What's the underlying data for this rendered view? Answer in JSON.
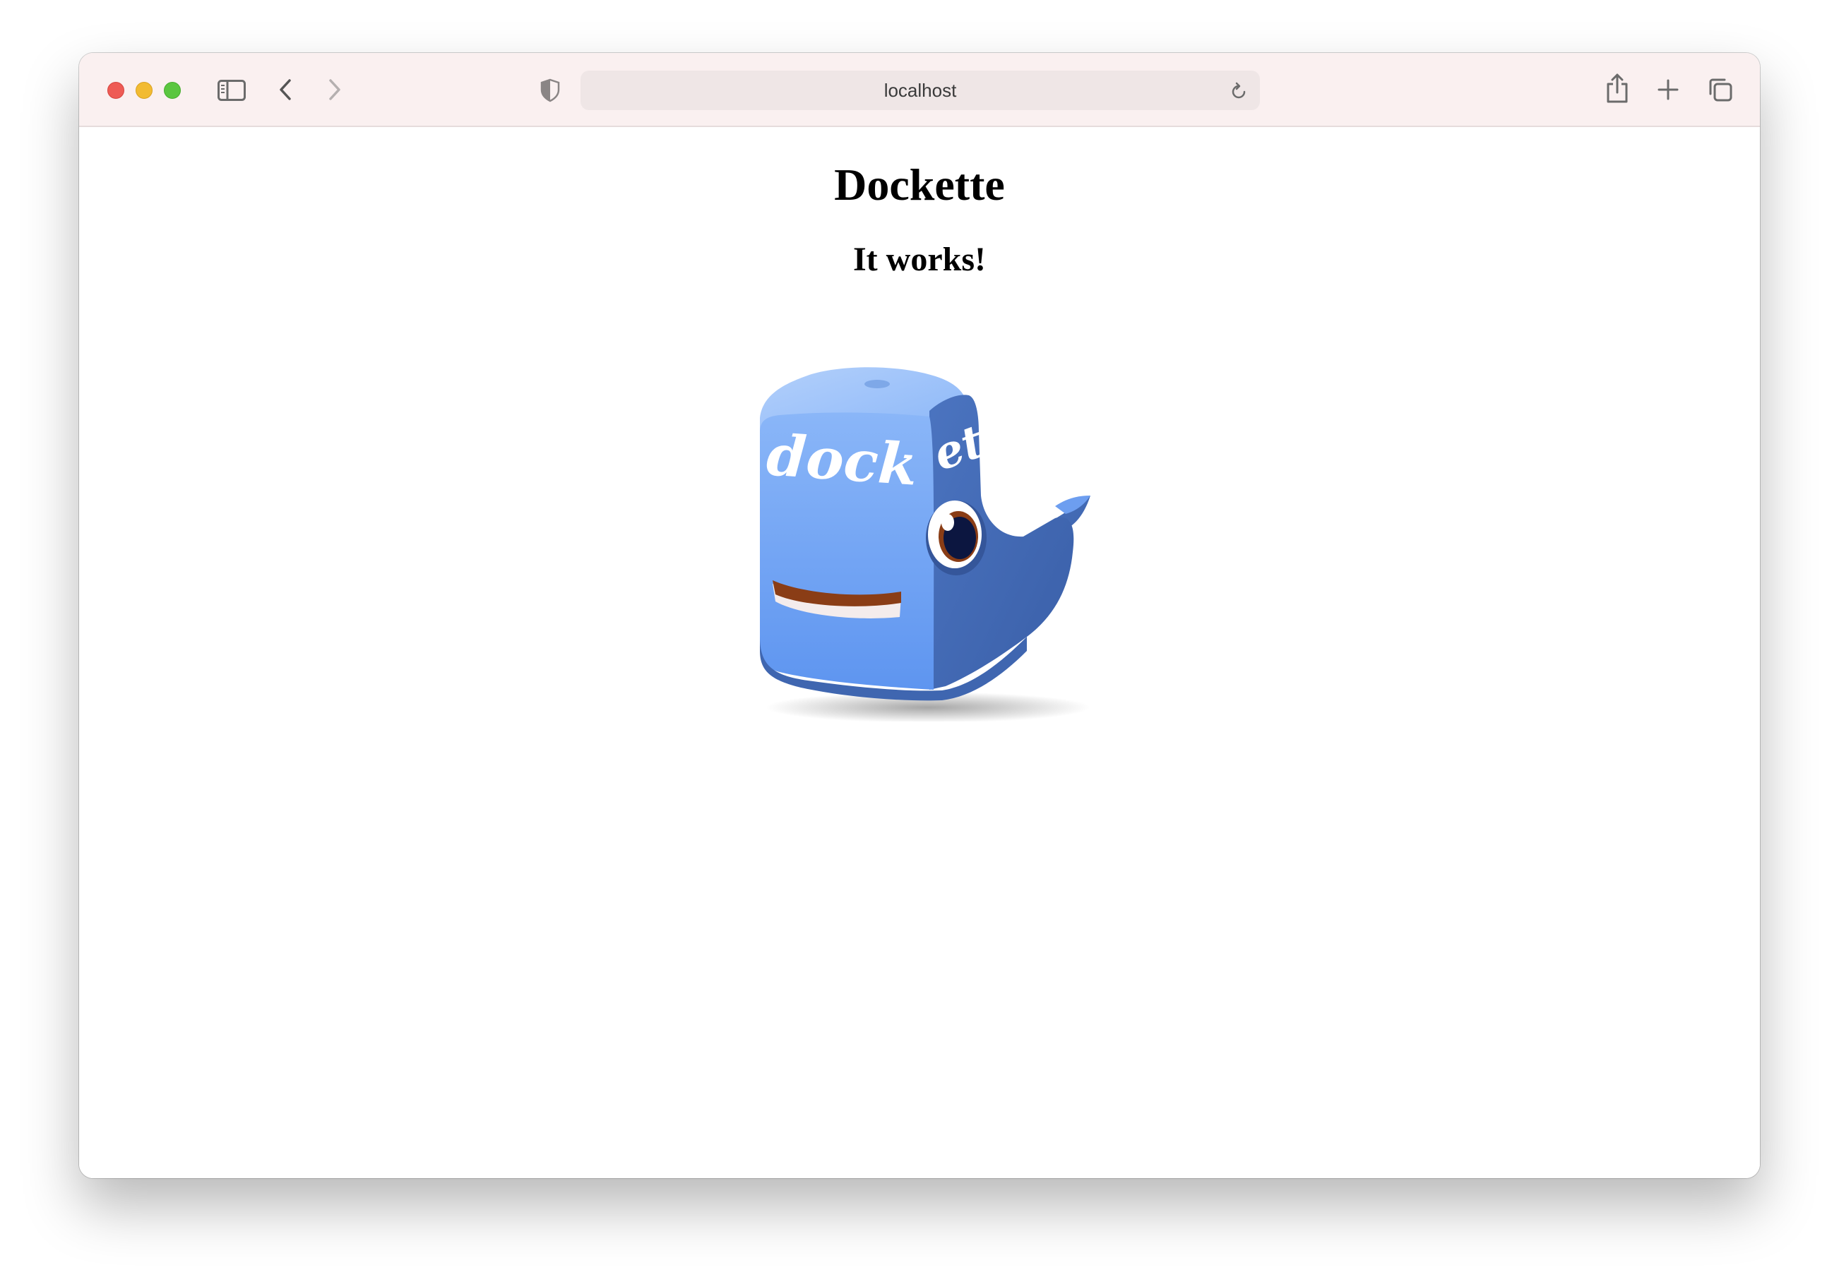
{
  "browser": {
    "address": "localhost",
    "icons": {
      "sidebar": "sidebar-icon",
      "back": "chevron-left-icon",
      "forward": "chevron-right-icon",
      "privacy": "shield-icon",
      "reload": "reload-icon",
      "share": "share-icon",
      "new_tab": "plus-icon",
      "tabs": "tab-overview-icon"
    }
  },
  "page": {
    "title": "Dockette",
    "subtitle": "It works!",
    "logo": {
      "word_left": "dock",
      "word_right": "ette",
      "colors": {
        "body_light": "#8ab6f8",
        "body_dark": "#3f66b0",
        "mouth": "#8a3d16"
      }
    }
  }
}
